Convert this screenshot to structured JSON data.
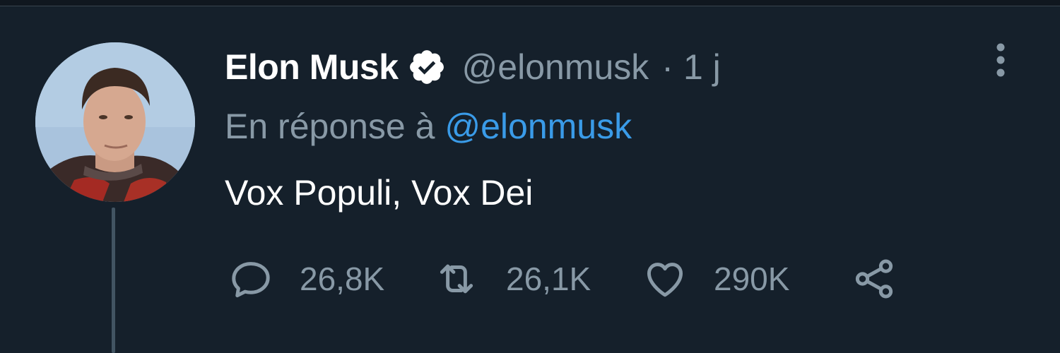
{
  "tweet": {
    "author": {
      "display_name": "Elon Musk",
      "handle": "@elonmusk",
      "verified": true
    },
    "separator": "·",
    "timestamp": "1 j",
    "reply_to": {
      "prefix": "En réponse à",
      "mention": "@elonmusk"
    },
    "text": "Vox Populi, Vox Dei",
    "stats": {
      "replies": "26,8K",
      "retweets": "26,1K",
      "likes": "290K"
    }
  },
  "icons": {
    "verified": "verified-badge-icon",
    "more": "more-vertical-icon",
    "reply": "reply-icon",
    "retweet": "retweet-icon",
    "like": "heart-icon",
    "share": "share-icon"
  },
  "colors": {
    "background": "#15202b",
    "text_primary": "#ffffff",
    "text_secondary": "#8899a6",
    "accent": "#3a9be8"
  }
}
